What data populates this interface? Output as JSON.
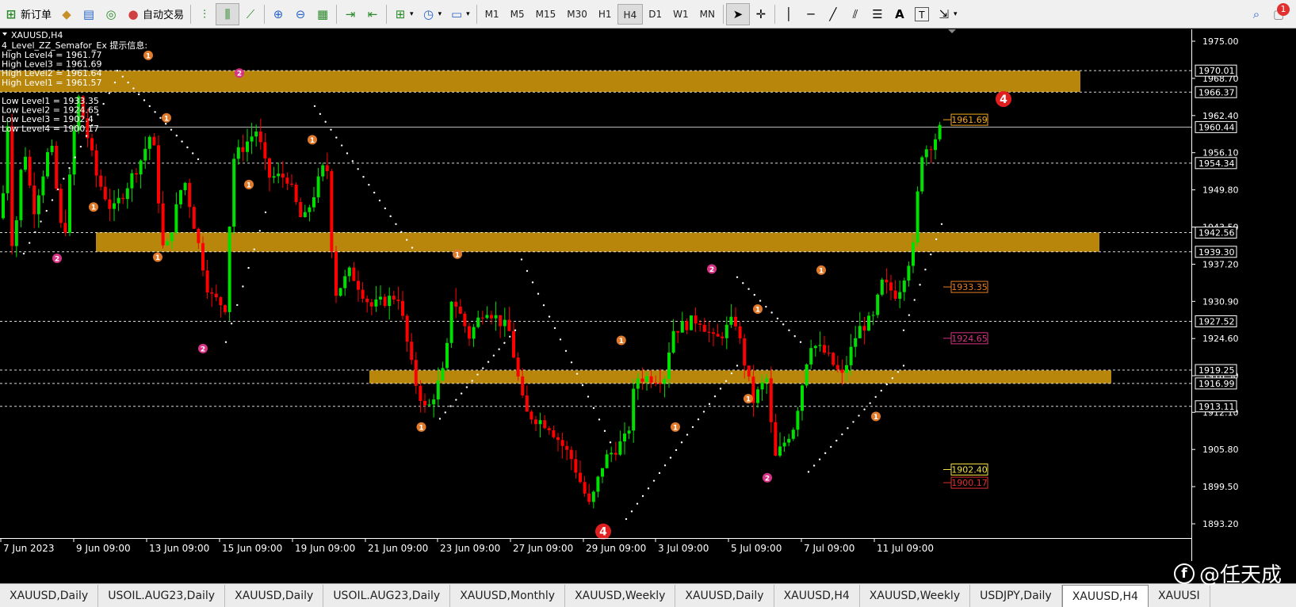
{
  "toolbar": {
    "new_order": "新订单",
    "auto_trade": "自动交易",
    "timeframes": [
      "M1",
      "M5",
      "M15",
      "M30",
      "H1",
      "H4",
      "D1",
      "W1",
      "MN"
    ],
    "active_timeframe": "H4",
    "notification_count": "1"
  },
  "chart": {
    "symbol_title": "XAUUSD,H4",
    "indicator_title": "4_Level_ZZ_Semafor_Ex 提示信息:",
    "levels_text": [
      "High Level4 = 1961.77",
      "High Level3 = 1961.69",
      "High Level2 = 1961.64",
      "High Level1 = 1961.57",
      "",
      "Low Level1 = 1933.35",
      "Low Level2 = 1924.65",
      "Low Level3 = 1902.4",
      "Low Level4 = 1900.17"
    ],
    "price_ticks": [
      1975.0,
      1968.7,
      1962.4,
      1956.1,
      1949.8,
      1943.5,
      1937.2,
      1930.9,
      1924.6,
      1918.3,
      1912.1,
      1905.8,
      1899.5,
      1893.2
    ],
    "price_labels": [
      "1975.00",
      "1968.70",
      "1962.40",
      "1956.10",
      "1949.80",
      "1943.50",
      "1937.20",
      "1930.90",
      "1924.60",
      "1918.30",
      "1912.10",
      "1905.80",
      "1899.50",
      "1893.20"
    ],
    "h_lines": [
      {
        "price": 1970.01,
        "label": "1970.01"
      },
      {
        "price": 1966.37,
        "label": "1966.37"
      },
      {
        "price": 1954.34,
        "label": "1954.34"
      },
      {
        "price": 1942.56,
        "label": "1942.56"
      },
      {
        "price": 1939.3,
        "label": "1939.30"
      },
      {
        "price": 1927.52,
        "label": "1927.52"
      },
      {
        "price": 1919.25,
        "label": "1919.25"
      },
      {
        "price": 1916.99,
        "label": "1916.99"
      },
      {
        "price": 1913.11,
        "label": "1913.11"
      }
    ],
    "current_price": {
      "price": 1960.44,
      "label": "1960.44"
    },
    "zones": [
      {
        "top": 1970.0,
        "bottom": 1966.4,
        "start_date": "7 Jun 2023",
        "end_date": "14 Jul 2023"
      },
      {
        "top": 1942.6,
        "bottom": 1939.3,
        "start_date": "12 Jun 2023",
        "end_date": "14 Jul 2023"
      },
      {
        "top": 1919.2,
        "bottom": 1917.0,
        "start_date": "20 Jun 2023",
        "end_date": "14 Jul 2023"
      }
    ],
    "level_tags": [
      {
        "label": "1961.69",
        "price": 1961.69,
        "color": "#f5a623"
      },
      {
        "label": "1933.35",
        "price": 1933.35,
        "color": "#e67e22"
      },
      {
        "label": "1924.65",
        "price": 1924.65,
        "color": "#d63384"
      },
      {
        "label": "1902.40",
        "price": 1902.4,
        "color": "#f0e040"
      },
      {
        "label": "1900.17",
        "price": 1900.17,
        "color": "#e03030"
      }
    ],
    "time_labels": [
      "7 Jun 2023",
      "9 Jun 09:00",
      "13 Jun 09:00",
      "15 Jun 09:00",
      "19 Jun 09:00",
      "21 Jun 09:00",
      "23 Jun 09:00",
      "27 Jun 09:00",
      "29 Jun 09:00",
      "3 Jul 09:00",
      "5 Jul 09:00",
      "7 Jul 09:00",
      "11 Jul 09:00"
    ],
    "semafor_marks": [
      {
        "date": "8 Jun 2023",
        "label": "2",
        "level": 2,
        "price": 1938.2
      },
      {
        "date": "9 Jun 2023",
        "label": "1",
        "level": 1,
        "price": 1946.9
      },
      {
        "date": "12 Jun 2023",
        "label": "1",
        "level": 1,
        "price": 1972.6
      },
      {
        "date": "12 Jun 2023",
        "label": "1",
        "level": 1,
        "price": 1938.4
      },
      {
        "date": "13 Jun 2023",
        "label": "1",
        "level": 1,
        "price": 1962.0
      },
      {
        "date": "14 Jun 2023",
        "label": "2",
        "level": 2,
        "price": 1922.9
      },
      {
        "date": "15 Jun 2023",
        "label": "2",
        "level": 2,
        "price": 1969.6
      },
      {
        "date": "15 Jun 2023",
        "label": "1",
        "level": 1,
        "price": 1950.7
      },
      {
        "date": "19 Jun 2023",
        "label": "1",
        "level": 1,
        "price": 1958.3
      },
      {
        "date": "22 Jun 2023",
        "label": "1",
        "level": 1,
        "price": 1909.6
      },
      {
        "date": "23 Jun 2023",
        "label": "1",
        "level": 1,
        "price": 1938.9
      },
      {
        "date": "29 Jun 2023",
        "label": "4",
        "level": 4,
        "price": 1891.9
      },
      {
        "date": "30 Jun 2023",
        "label": "1",
        "level": 1,
        "price": 1924.3
      },
      {
        "date": "3 Jul 2023",
        "label": "1",
        "level": 1,
        "price": 1909.6
      },
      {
        "date": "4 Jul 2023",
        "label": "2",
        "level": 2,
        "price": 1936.4
      },
      {
        "date": "5 Jul 2023",
        "label": "1",
        "level": 1,
        "price": 1914.4
      },
      {
        "date": "5 Jul 2023",
        "label": "1",
        "level": 1,
        "price": 1929.6
      },
      {
        "date": "5 Jul 2023",
        "label": "2",
        "level": 2,
        "price": 1901.0
      },
      {
        "date": "7 Jul 2023",
        "label": "1",
        "level": 1,
        "price": 1936.2
      },
      {
        "date": "10 Jul 2023",
        "label": "1",
        "level": 1,
        "price": 1911.4
      },
      {
        "date": "14 Jul 2023",
        "label": "4",
        "level": 4,
        "price": 1965.2
      }
    ]
  },
  "tabs": [
    "XAUUSD,Daily",
    "USOIL.AUG23,Daily",
    "XAUUSD,Daily",
    "USOIL.AUG23,Daily",
    "XAUUSD,Monthly",
    "XAUUSD,Weekly",
    "XAUUSD,Daily",
    "XAUUSD,H4",
    "XAUUSD,Weekly",
    "USDJPY,Daily",
    "XAUUSD,H4",
    "XAUUSI"
  ],
  "active_tab_index": 10,
  "watermark": "@任天成",
  "colors": {
    "bull": "#00e000",
    "bear": "#ff0000",
    "zone": "#b8860b",
    "grid": "#ffffff",
    "axis_bg": "#000000"
  }
}
